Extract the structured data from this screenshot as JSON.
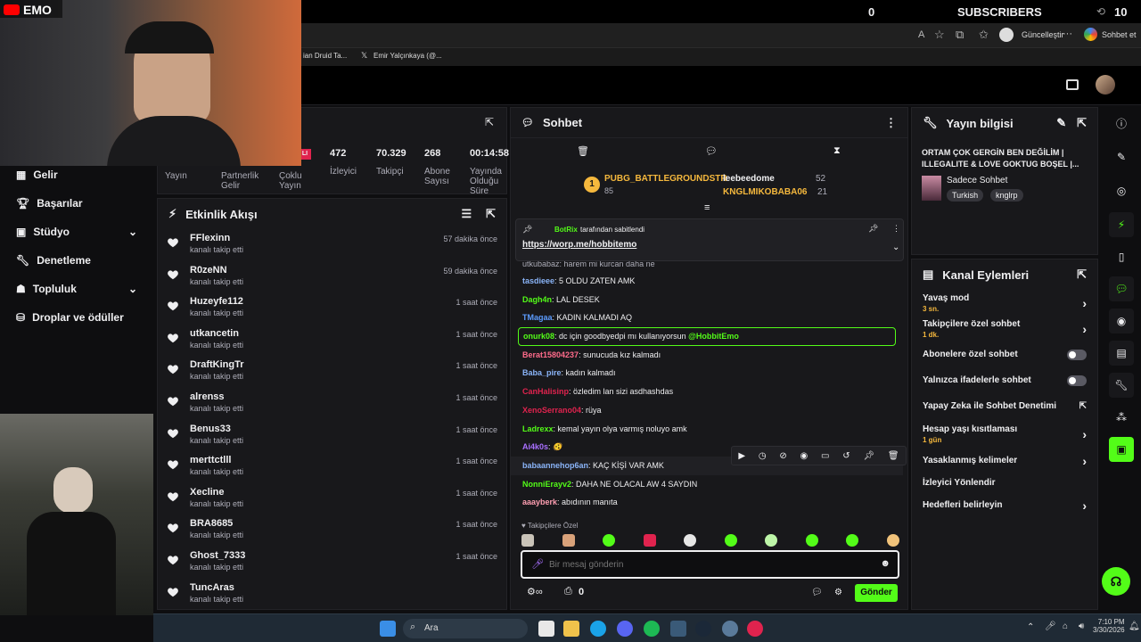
{
  "overlay": {
    "channel": "EMO",
    "sub_count": "0",
    "subscribers_label": "SUBSCRIBERS",
    "sub_goal": "10",
    "sub_goal_controls": "⟲"
  },
  "browser": {
    "tabs": [
      "ian Druid Ta...",
      "Emir Yalçınkaya (@..."
    ],
    "update_label": "Güncelleştir",
    "chat_label": "Sohbet et"
  },
  "left_nav": {
    "items": [
      {
        "label": "Gelir",
        "icon": "revenue-icon"
      },
      {
        "label": "Başarılar",
        "icon": "trophy-icon"
      },
      {
        "label": "Stüdyo",
        "icon": "studio-icon",
        "chevron": true
      },
      {
        "label": "Denetleme",
        "icon": "wrench-icon"
      },
      {
        "label": "Topluluk",
        "icon": "community-icon",
        "chevron": true
      },
      {
        "label": "Droplar ve ödüller",
        "icon": "drops-icon"
      }
    ]
  },
  "stats": {
    "labels": [
      "Yayın",
      "Partnerlik Gelir",
      "Çoklu Yayın",
      "İzleyici",
      "Takipçi",
      "Abone Sayısı",
      "Yayında Olduğu Süre"
    ],
    "values": {
      "viewers": "472",
      "followers": "70.329",
      "subs": "268",
      "uptime": "00:14:58",
      "live": "LI"
    }
  },
  "activity": {
    "title": "Etkinlik Akışı",
    "events": [
      {
        "name": "FFlexinn",
        "sub": "kanalı takip etti",
        "time": "57 dakika önce"
      },
      {
        "name": "R0zeNN",
        "sub": "kanalı takip etti",
        "time": "59 dakika önce"
      },
      {
        "name": "Huzeyfe112",
        "sub": "kanalı takip etti",
        "time": "1 saat önce"
      },
      {
        "name": "utkancetin",
        "sub": "kanalı takip etti",
        "time": "1 saat önce"
      },
      {
        "name": "DraftKingTr",
        "sub": "kanalı takip etti",
        "time": "1 saat önce"
      },
      {
        "name": "alrenss",
        "sub": "kanalı takip etti",
        "time": "1 saat önce"
      },
      {
        "name": "Benus33",
        "sub": "kanalı takip etti",
        "time": "1 saat önce"
      },
      {
        "name": "merttctlll",
        "sub": "kanalı takip etti",
        "time": "1 saat önce"
      },
      {
        "name": "Xecline",
        "sub": "kanalı takip etti",
        "time": "1 saat önce"
      },
      {
        "name": "BRA8685",
        "sub": "kanalı takip etti",
        "time": "1 saat önce"
      },
      {
        "name": "Ghost_7333",
        "sub": "kanalı takip etti",
        "time": "1 saat önce"
      },
      {
        "name": "TuncAras",
        "sub": "kanalı takip etti",
        "time": ""
      }
    ]
  },
  "chat": {
    "title": "Sohbet",
    "leaders": {
      "rank": "1",
      "top_user": "PUBG_BATTLEGROUNDSTR",
      "top_count": "85",
      "second_user": "leebeedome",
      "second_count": "52",
      "third_user": "KNGLMIKOBABA06",
      "third_count": "21"
    },
    "pinned": {
      "by": "BotRix",
      "by_suffix": "tarafından sabitlendi",
      "link": "https://worp.me/hobbitemo",
      "cutoff": "utkubabaz: harem mi kurcan daha ne"
    },
    "messages": [
      {
        "user": "tasdieee",
        "text": ": 5 OLDU ZATEN AMK",
        "color": "#8ab4f8"
      },
      {
        "user": "Dagh4n",
        "text": ": LAL DESEK",
        "color": "#53fc18"
      },
      {
        "user": "TMagaa",
        "text": ": KADIN KALMADI AQ",
        "color": "#5c9cff"
      },
      {
        "user": "onurk08",
        "text": ": dc için goodbyedpi mı kullanıyorsun ",
        "mention": "@HobbitEmo",
        "color": "#53fc18",
        "highlight": true
      },
      {
        "user": "Berat15804237",
        "text": ": sunucuda kız kalmadı",
        "color": "#ff6b8b"
      },
      {
        "user": "Baba_pire",
        "text": ": kadın kalmadı",
        "color": "#8ab4f8"
      },
      {
        "user": "CanHalisinp",
        "text": ": özledim lan sizi asdhashdas",
        "color": "#e0234e"
      },
      {
        "user": "XenoSerrano04",
        "text": ": rüya",
        "color": "#e0234e"
      },
      {
        "user": "Ladrexx",
        "text": ": kemal yayın olya varmış noluyo amk",
        "color": "#53fc18"
      },
      {
        "user": "Ai4k0s",
        "text": ": 🫨",
        "color": "#a970ff"
      },
      {
        "user": "babaannehop6an",
        "text": ": KAÇ KİŞİ VAR AMK",
        "color": "#8ab4f8",
        "hover": true
      },
      {
        "user": "NonniErayv2",
        "text": ": DAHA NE OLACAL AW 4 SAYDIN",
        "color": "#53fc18"
      },
      {
        "user": "aaayberk",
        "text": ": abıdının manıta",
        "color": "#ff9fb2"
      }
    ],
    "followers_only_label": "Takipçilere Özel",
    "input_placeholder": "Bir mesaj gönderin",
    "points": "0",
    "send_label": "Gönder"
  },
  "stream_info": {
    "title": "Yayın bilgisi",
    "stream_title": "ORTAM ÇOK GERGİN BEN DEĞİLİM | ILLEGALITE & LOVE GOKTUG BOŞEL |...",
    "category": "Sadece Sohbet",
    "tags": [
      "Turkish",
      "knglrp"
    ]
  },
  "channel_actions": {
    "title": "Kanal Eylemleri",
    "rows": [
      {
        "label": "Yavaş mod",
        "sub": "3 sn.",
        "type": "chevron"
      },
      {
        "label": "Takipçilere özel sohbet",
        "sub": "1 dk.",
        "type": "chevron"
      },
      {
        "label": "Abonelere özel sohbet",
        "sub": "",
        "type": "toggle"
      },
      {
        "label": "Yalnızca ifadelerle sohbet",
        "sub": "",
        "type": "toggle"
      },
      {
        "label": "Yapay Zeka ile Sohbet Denetimi",
        "sub": "",
        "type": "external"
      },
      {
        "label": "Hesap yaşı kısıtlaması",
        "sub": "1 gün",
        "type": "chevron"
      },
      {
        "label": "Yasaklanmış kelimeler",
        "sub": "",
        "type": "chevron"
      },
      {
        "label": "İzleyici Yönlendir",
        "sub": "",
        "type": "none"
      },
      {
        "label": "Hedefleri belirleyin",
        "sub": "",
        "type": "chevron"
      }
    ]
  },
  "taskbar": {
    "search_placeholder": "Ara",
    "time": "7:10 PM",
    "date": "3/30/2026"
  },
  "colors": {
    "accent": "#53fc18",
    "panel": "#18181b",
    "bg": "#0e0e10"
  }
}
